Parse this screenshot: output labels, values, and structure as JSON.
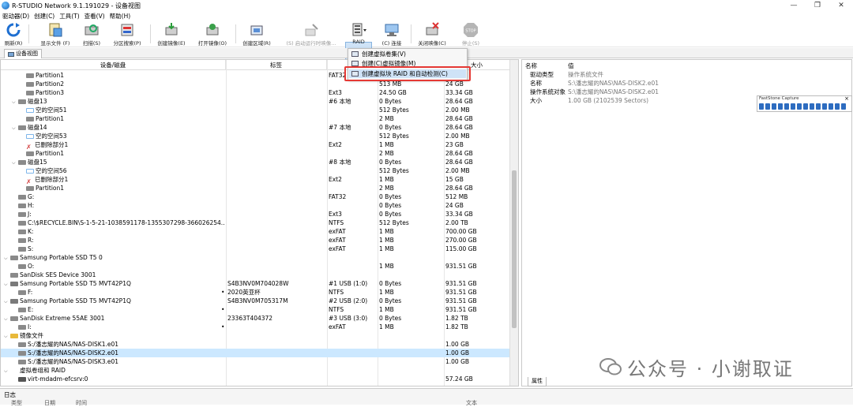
{
  "window": {
    "title": "R-STUDIO Network 9.1.191029 - 设备视图",
    "minimize": "—",
    "maximize": "❐",
    "close": "✕"
  },
  "menu": [
    "驱动器(D)",
    "创建(C)",
    "工具(T)",
    "查看(V)",
    "帮助(H)"
  ],
  "toolbar": [
    {
      "label": "刷新(R)",
      "disabled": false
    },
    {
      "label": "显示文件 (F)",
      "disabled": false
    },
    {
      "label": "扫描(S)",
      "disabled": false
    },
    {
      "label": "分区搜索(P)",
      "disabled": false
    },
    {
      "label": "创建镜像(E)",
      "disabled": false
    },
    {
      "label": "打开镜像(O)",
      "disabled": false
    },
    {
      "label": "创建区域(R)",
      "disabled": false
    },
    {
      "label": "(S) 启动运行时映像...",
      "disabled": true
    },
    {
      "label": "RAID",
      "disabled": false
    },
    {
      "label": "(C) 连接",
      "disabled": false
    },
    {
      "label": "关闭映像(C)",
      "disabled": false
    },
    {
      "label": "停止(S)",
      "disabled": true
    }
  ],
  "stop_icon_text": "STOP",
  "tab": {
    "label": "设备视图"
  },
  "columns": {
    "device": "设备/磁盘",
    "label": "标签",
    "fs": "",
    "start": "",
    "size": "大小"
  },
  "rows": [
    {
      "indent": 2,
      "icon": "part",
      "name": "Partition1",
      "label": "",
      "fs": "FAT32",
      "start": "1 MB",
      "size": "",
      "exp": ""
    },
    {
      "indent": 2,
      "icon": "part",
      "name": "Partition2",
      "label": "",
      "fs": "",
      "start": "513 MB",
      "size": "24 GB",
      "exp": ""
    },
    {
      "indent": 2,
      "icon": "part",
      "name": "Partition3",
      "label": "",
      "fs": "Ext3",
      "start": "24.50 GB",
      "size": "33.34 GB",
      "exp": ""
    },
    {
      "indent": 1,
      "icon": "disk",
      "name": "磁盘13",
      "label": "",
      "fs": "#6 本地",
      "start": "0 Bytes",
      "size": "28.64 GB",
      "exp": "v"
    },
    {
      "indent": 2,
      "icon": "free",
      "name": "空的空间51",
      "label": "",
      "fs": "",
      "start": "512 Bytes",
      "size": "2.00 MB",
      "exp": ""
    },
    {
      "indent": 2,
      "icon": "part",
      "name": "Partition1",
      "label": "",
      "fs": "",
      "start": "2 MB",
      "size": "28.64 GB",
      "exp": ""
    },
    {
      "indent": 1,
      "icon": "disk",
      "name": "磁盘14",
      "label": "",
      "fs": "#7 本地",
      "start": "0 Bytes",
      "size": "28.64 GB",
      "exp": "v"
    },
    {
      "indent": 2,
      "icon": "free",
      "name": "空的空间53",
      "label": "",
      "fs": "",
      "start": "512 Bytes",
      "size": "2.00 MB",
      "exp": ""
    },
    {
      "indent": 2,
      "icon": "del",
      "name": "已删除部分1",
      "label": "",
      "fs": "Ext2",
      "start": "1 MB",
      "size": "23 GB",
      "exp": ""
    },
    {
      "indent": 2,
      "icon": "part",
      "name": "Partition1",
      "label": "",
      "fs": "",
      "start": "2 MB",
      "size": "28.64 GB",
      "exp": ""
    },
    {
      "indent": 1,
      "icon": "disk",
      "name": "磁盘15",
      "label": "",
      "fs": "#8 本地",
      "start": "0 Bytes",
      "size": "28.64 GB",
      "exp": "v"
    },
    {
      "indent": 2,
      "icon": "free",
      "name": "空的空间56",
      "label": "",
      "fs": "",
      "start": "512 Bytes",
      "size": "2.00 MB",
      "exp": ""
    },
    {
      "indent": 2,
      "icon": "del",
      "name": "已删除部分1",
      "label": "",
      "fs": "Ext2",
      "start": "1 MB",
      "size": "15 GB",
      "exp": ""
    },
    {
      "indent": 2,
      "icon": "part",
      "name": "Partition1",
      "label": "",
      "fs": "",
      "start": "2 MB",
      "size": "28.64 GB",
      "exp": ""
    },
    {
      "indent": 1,
      "icon": "part",
      "name": "G:",
      "label": "",
      "fs": "FAT32",
      "start": "0 Bytes",
      "size": "512 MB",
      "exp": ""
    },
    {
      "indent": 1,
      "icon": "part",
      "name": "H:",
      "label": "",
      "fs": "",
      "start": "0 Bytes",
      "size": "24 GB",
      "exp": ""
    },
    {
      "indent": 1,
      "icon": "part",
      "name": "J:",
      "label": "",
      "fs": "Ext3",
      "start": "0 Bytes",
      "size": "33.34 GB",
      "exp": ""
    },
    {
      "indent": 1,
      "icon": "part",
      "name": "C:\\$RECYCLE.BIN\\S-1-5-21-1038591178-1355307298-366026254...",
      "label": "",
      "fs": "NTFS",
      "start": "512 Bytes",
      "size": "2.00 TB",
      "exp": ""
    },
    {
      "indent": 1,
      "icon": "part",
      "name": "K:",
      "label": "",
      "fs": "exFAT",
      "start": "1 MB",
      "size": "700.00 GB",
      "exp": ""
    },
    {
      "indent": 1,
      "icon": "part",
      "name": "R:",
      "label": "",
      "fs": "exFAT",
      "start": "1 MB",
      "size": "270.00 GB",
      "exp": ""
    },
    {
      "indent": 1,
      "icon": "part",
      "name": "S:",
      "label": "",
      "fs": "exFAT",
      "start": "1 MB",
      "size": "115.00 GB",
      "exp": ""
    },
    {
      "indent": 0,
      "icon": "disk",
      "name": "Samsung Portable SSD T5 0",
      "label": "",
      "fs": "",
      "start": "",
      "size": "",
      "exp": "v"
    },
    {
      "indent": 1,
      "icon": "part",
      "name": "O:",
      "label": "",
      "fs": "",
      "start": "1 MB",
      "size": "931.51 GB",
      "exp": ""
    },
    {
      "indent": 0,
      "icon": "disk",
      "name": "SanDisk SES Device 3001",
      "label": "",
      "fs": "",
      "start": "",
      "size": "",
      "exp": ""
    },
    {
      "indent": 0,
      "icon": "usb",
      "name": "Samsung Portable SSD T5 MVT42P1Q",
      "label": "S4B3NV0M704028W",
      "fs": "#1 USB (1:0)",
      "start": "0 Bytes",
      "size": "931.51 GB",
      "exp": "v"
    },
    {
      "indent": 1,
      "icon": "part",
      "name": "F:",
      "label": "2020英亚杯",
      "fs": "NTFS",
      "start": "1 MB",
      "size": "931.51 GB",
      "exp": "",
      "mark": "•"
    },
    {
      "indent": 0,
      "icon": "usb",
      "name": "Samsung Portable SSD T5 MVT42P1Q",
      "label": "S4B3NV0M705317M",
      "fs": "#2 USB (2:0)",
      "start": "0 Bytes",
      "size": "931.51 GB",
      "exp": "v"
    },
    {
      "indent": 1,
      "icon": "part",
      "name": "E:",
      "label": "",
      "fs": "NTFS",
      "start": "1 MB",
      "size": "931.51 GB",
      "exp": "",
      "mark": "•"
    },
    {
      "indent": 0,
      "icon": "disk",
      "name": "SanDisk Extreme 55AE 3001",
      "label": "23363T404372",
      "fs": "#3 USB (3:0)",
      "start": "0 Bytes",
      "size": "1.82 TB",
      "exp": "v"
    },
    {
      "indent": 1,
      "icon": "part",
      "name": "I:",
      "label": "",
      "fs": "exFAT",
      "start": "1 MB",
      "size": "1.82 TB",
      "exp": "",
      "mark": "•"
    },
    {
      "indent": 0,
      "icon": "folder",
      "name": "镜像文件",
      "label": "",
      "fs": "",
      "start": "",
      "size": "",
      "exp": "v"
    },
    {
      "indent": 1,
      "icon": "img",
      "name": "S:/潘志耀的NAS/NAS-DISK1.e01",
      "label": "",
      "fs": "",
      "start": "",
      "size": "1.00 GB",
      "exp": ""
    },
    {
      "indent": 1,
      "icon": "img",
      "name": "S:/潘志耀的NAS/NAS-DISK2.e01",
      "label": "",
      "fs": "",
      "start": "",
      "size": "1.00 GB",
      "exp": "",
      "selected": true
    },
    {
      "indent": 1,
      "icon": "img",
      "name": "S:/潘志耀的NAS/NAS-DISK3.e01",
      "label": "",
      "fs": "",
      "start": "",
      "size": "1.00 GB",
      "exp": ""
    },
    {
      "indent": 0,
      "icon": "none",
      "name": "虚拟卷组和 RAID",
      "label": "",
      "fs": "",
      "start": "",
      "size": "",
      "exp": "v"
    },
    {
      "indent": 1,
      "icon": "raid",
      "name": "virt-mdadm-efcsrv:0",
      "label": "",
      "fs": "",
      "start": "",
      "size": "57.24 GB",
      "exp": ""
    }
  ],
  "raid_menu": [
    {
      "label": "创建虚拟卷集(V)"
    },
    {
      "label": "创建(C)虚拟镜像(M)"
    },
    {
      "label": "创建虚拟块 RAID 和自动检测(C)",
      "highlight": true
    }
  ],
  "properties": {
    "head_name": "名称",
    "head_value": "值",
    "rows": [
      {
        "k": "驱动类型",
        "v": "操作系统文件",
        "indent": 1
      },
      {
        "k": "名称",
        "v": "S:\\潘志耀的NAS\\NAS-DISK2.e01",
        "indent": 1
      },
      {
        "k": "操作系统对象",
        "v": "S:\\潘志耀的NAS\\NAS-DISK2.e01",
        "indent": 1
      },
      {
        "k": "大小",
        "v": "1.00 GB (2102539 Sectors)",
        "indent": 1
      }
    ],
    "tab": "属性"
  },
  "fastone": {
    "title": "FastStone Capture",
    "close": "×"
  },
  "log": {
    "title": "日志",
    "cols": [
      "类型",
      "日期",
      "时间",
      "文本"
    ]
  },
  "watermark": {
    "text": "公众号 · 小谢取证"
  },
  "colors": {
    "selection": "#cce8ff",
    "menu_highlight": "#cfe3f7",
    "red_box": "#e53935"
  }
}
